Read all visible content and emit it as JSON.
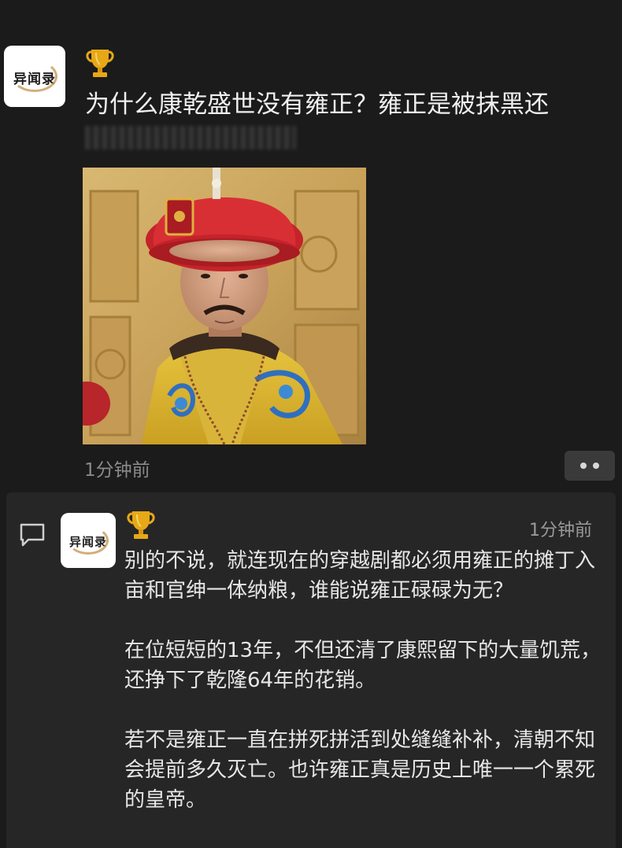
{
  "post": {
    "avatar_logo": "异闻录",
    "title": "为什么康乾盛世没有雍正？雍正是被抹黑还",
    "timestamp": "1分钟前",
    "trophy_icon": "trophy-icon",
    "more_icon": "more-dots-icon",
    "image_icon": "emperor-photo"
  },
  "comment": {
    "avatar_logo": "异闻录",
    "timestamp": "1分钟前",
    "comment_icon": "comment-bubble-icon",
    "paragraphs": [
      "别的不说，就连现在的穿越剧都必须用雍正的摊丁入亩和官绅一体纳粮，谁能说雍正碌碌为无？",
      "在位短短的13年，不但还清了康熙留下的大量饥荒，还挣下了乾隆64年的花销。",
      "若不是雍正一直在拼死拼活到处缝缝补补，清朝不知会提前多久灭亡。也许雍正真是历史上唯一一个累死的皇帝。"
    ]
  },
  "colors": {
    "background": "#1b1b1b",
    "panel": "#262626",
    "text": "#e8e8e8",
    "muted": "#8a8a8a",
    "gold": "#e0a21c"
  }
}
